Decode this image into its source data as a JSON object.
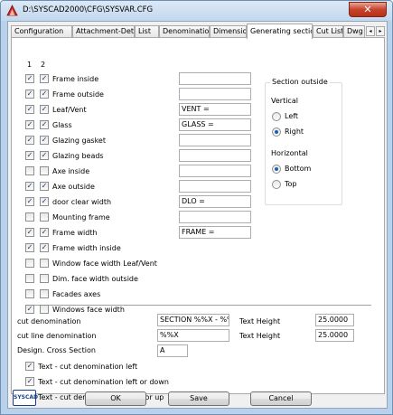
{
  "window": {
    "title": "D:\\SYSCAD2000\\CFG\\SYSVAR.CFG",
    "close_glyph": "✕"
  },
  "tabs": [
    {
      "label": "Configuration"
    },
    {
      "label": "Attachment-Details"
    },
    {
      "label": "List"
    },
    {
      "label": "Denomination"
    },
    {
      "label": "Dimension"
    },
    {
      "label": "Generating sections",
      "active": true
    },
    {
      "label": "Cut List"
    },
    {
      "label": "Dwg S"
    }
  ],
  "tab_scroll": {
    "left": "◂",
    "right": "▸"
  },
  "columns": {
    "c1": "1",
    "c2": "2"
  },
  "rows": [
    {
      "label": "Frame inside",
      "c1": true,
      "c2": true,
      "field": ""
    },
    {
      "label": "Frame outside",
      "c1": true,
      "c2": true,
      "field": ""
    },
    {
      "label": "Leaf/Vent",
      "c1": true,
      "c2": true,
      "field": "VENT ="
    },
    {
      "label": "Glass",
      "c1": true,
      "c2": true,
      "field": "GLASS ="
    },
    {
      "label": "Glazing gasket",
      "c1": true,
      "c2": true,
      "field": ""
    },
    {
      "label": "Glazing beads",
      "c1": true,
      "c2": true,
      "field": ""
    },
    {
      "label": "Axe inside",
      "c1": false,
      "c2": false,
      "field": ""
    },
    {
      "label": "Axe outside",
      "c1": true,
      "c2": true,
      "field": ""
    },
    {
      "label": "door clear width",
      "c1": true,
      "c2": true,
      "field": "DLO ="
    },
    {
      "label": "Mounting frame",
      "c1": false,
      "c2": false,
      "field": ""
    },
    {
      "label": "Frame width",
      "c1": true,
      "c2": true,
      "field": "FRAME ="
    },
    {
      "label": "Frame width inside",
      "c1": true,
      "c2": true
    },
    {
      "label": "Window face width Leaf/Vent",
      "c1": false,
      "c2": false
    },
    {
      "label": "Dim. face width outside",
      "c1": false,
      "c2": false
    },
    {
      "label": "Facades axes",
      "c1": false,
      "c2": false
    },
    {
      "label": "Windows face width",
      "c1": true,
      "c2": false
    }
  ],
  "section_outside": {
    "title": "Section outside",
    "vertical_label": "Vertical",
    "left": "Left",
    "right": "Right",
    "horizontal_label": "Horizontal",
    "bottom": "Bottom",
    "top": "Top",
    "vertical_selected": "Right",
    "horizontal_selected": "Bottom"
  },
  "denomination": {
    "cut_label": "cut denomination",
    "cut_value": "SECTION %%X - %%X",
    "cut_line_label": "cut line denomination",
    "cut_line_value": "%%X",
    "text_height_label_1": "Text Height",
    "text_height_value_1": "25.0000",
    "text_height_label_2": "Text Height",
    "text_height_value_2": "25.0000",
    "design_label": "Design. Cross Section",
    "design_value": "A"
  },
  "options": [
    {
      "label": "Text - cut denomination left",
      "checked": true
    },
    {
      "label": "Text - cut denomination left or down",
      "checked": true
    },
    {
      "label": "Text - cut denomination right or up",
      "checked": true
    }
  ],
  "buttons": {
    "ok": "OK",
    "save": "Save",
    "cancel": "Cancel"
  },
  "logo": "SYSCAD"
}
